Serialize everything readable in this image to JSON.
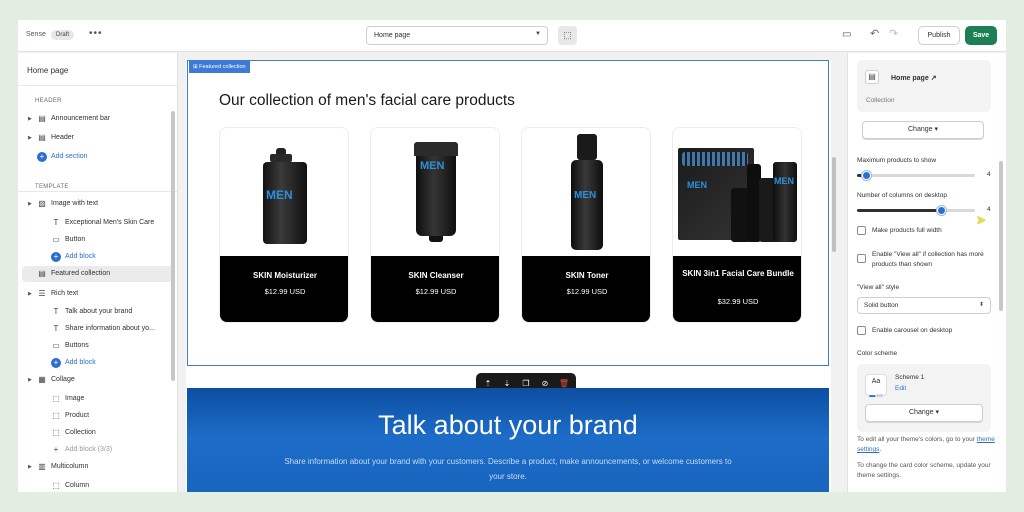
{
  "topbar": {
    "theme_name": "Sense",
    "draft_badge": "Draft",
    "more": "•••",
    "page_select": "Home page",
    "publish_label": "Publish",
    "save_label": "Save"
  },
  "sidebar": {
    "title": "Home page",
    "header_group": "HEADER",
    "template_group": "TEMPLATE",
    "items": [
      {
        "label": "Announcement bar",
        "icon": "layout-icon",
        "caret": true
      },
      {
        "label": "Header",
        "icon": "layout-icon",
        "caret": true
      },
      {
        "label": "Add section",
        "icon": "plus-circle-icon",
        "add": true
      },
      {
        "label": "Image with text",
        "icon": "image-text-icon",
        "caret": true
      },
      {
        "label": "Exceptional Men's Skin Care",
        "icon": "text-icon",
        "sub": true
      },
      {
        "label": "Button",
        "icon": "button-icon",
        "sub": true
      },
      {
        "label": "Add block",
        "icon": "plus-circle-icon",
        "add": true,
        "sub": true
      },
      {
        "label": "Featured collection",
        "icon": "collection-icon",
        "selected": true
      },
      {
        "label": "Rich text",
        "icon": "rich-text-icon",
        "caret": true
      },
      {
        "label": "Talk about your brand",
        "icon": "text-icon",
        "sub": true
      },
      {
        "label": "Share information about yo...",
        "icon": "text-icon",
        "sub": true
      },
      {
        "label": "Buttons",
        "icon": "button-icon",
        "sub": true
      },
      {
        "label": "Add block",
        "icon": "plus-circle-icon",
        "add": true,
        "sub": true
      },
      {
        "label": "Collage",
        "icon": "collage-icon",
        "caret": true
      },
      {
        "label": "Image",
        "icon": "dashed-square-icon",
        "sub": true
      },
      {
        "label": "Product",
        "icon": "dashed-square-icon",
        "sub": true
      },
      {
        "label": "Collection",
        "icon": "dashed-square-icon",
        "sub": true
      },
      {
        "label": "Add block (3/3)",
        "icon": "plus-circle-icon",
        "sub": true,
        "dim": true
      },
      {
        "label": "Multicolumn",
        "icon": "columns-icon",
        "caret": true
      },
      {
        "label": "Column",
        "icon": "dashed-square-icon",
        "sub": true
      }
    ]
  },
  "canvas": {
    "section_tag": "Featured collection",
    "collection_title": "Our collection of men's facial care products",
    "products": [
      {
        "name": "SKIN Moisturizer",
        "price": "$12.99 USD",
        "image": "moisturizer-pump-bottle"
      },
      {
        "name": "SKIN Cleanser",
        "price": "$12.99 USD",
        "image": "cleanser-tube"
      },
      {
        "name": "SKIN Toner",
        "price": "$12.99 USD",
        "image": "toner-bottle"
      },
      {
        "name": "SKIN 3in1 Facial Care Bundle",
        "price": "$32.99 USD",
        "image": "bundle-box"
      }
    ],
    "product_logo_text": "MEN",
    "brand_title": "Talk about your brand",
    "brand_text": "Share information about your brand with your customers. Describe a product, make announcements, or welcome customers to your store."
  },
  "settings": {
    "page_title": "Home page",
    "page_subtitle": "Collection",
    "change_label": "Change",
    "max_products_label": "Maximum products to show",
    "max_products_value": "4",
    "max_products_fraction": 0.08,
    "columns_label": "Number of columns on desktop",
    "columns_value": "4",
    "columns_fraction": 0.72,
    "full_width_label": "Make products full width",
    "view_all_label": "Enable \"View all\" if collection has more products than shown",
    "view_all_style_label": "\"View all\" style",
    "view_all_style_value": "Solid button",
    "carousel_label": "Enable carousel on desktop",
    "color_scheme_label": "Color scheme",
    "scheme_swatch": "Aa",
    "scheme_name": "Scheme 1",
    "scheme_edit": "Edit",
    "scheme_change_label": "Change",
    "note1_a": "To edit all your theme's colors, go to your ",
    "note1_link": "theme settings",
    "note1_b": ".",
    "note2": "To change the card color scheme, update your theme settings."
  },
  "colors": {
    "accent": "#2c6ecb",
    "save": "#1f7f54",
    "selection": "#3d7ad6",
    "brand_bg": "#1664bd"
  }
}
